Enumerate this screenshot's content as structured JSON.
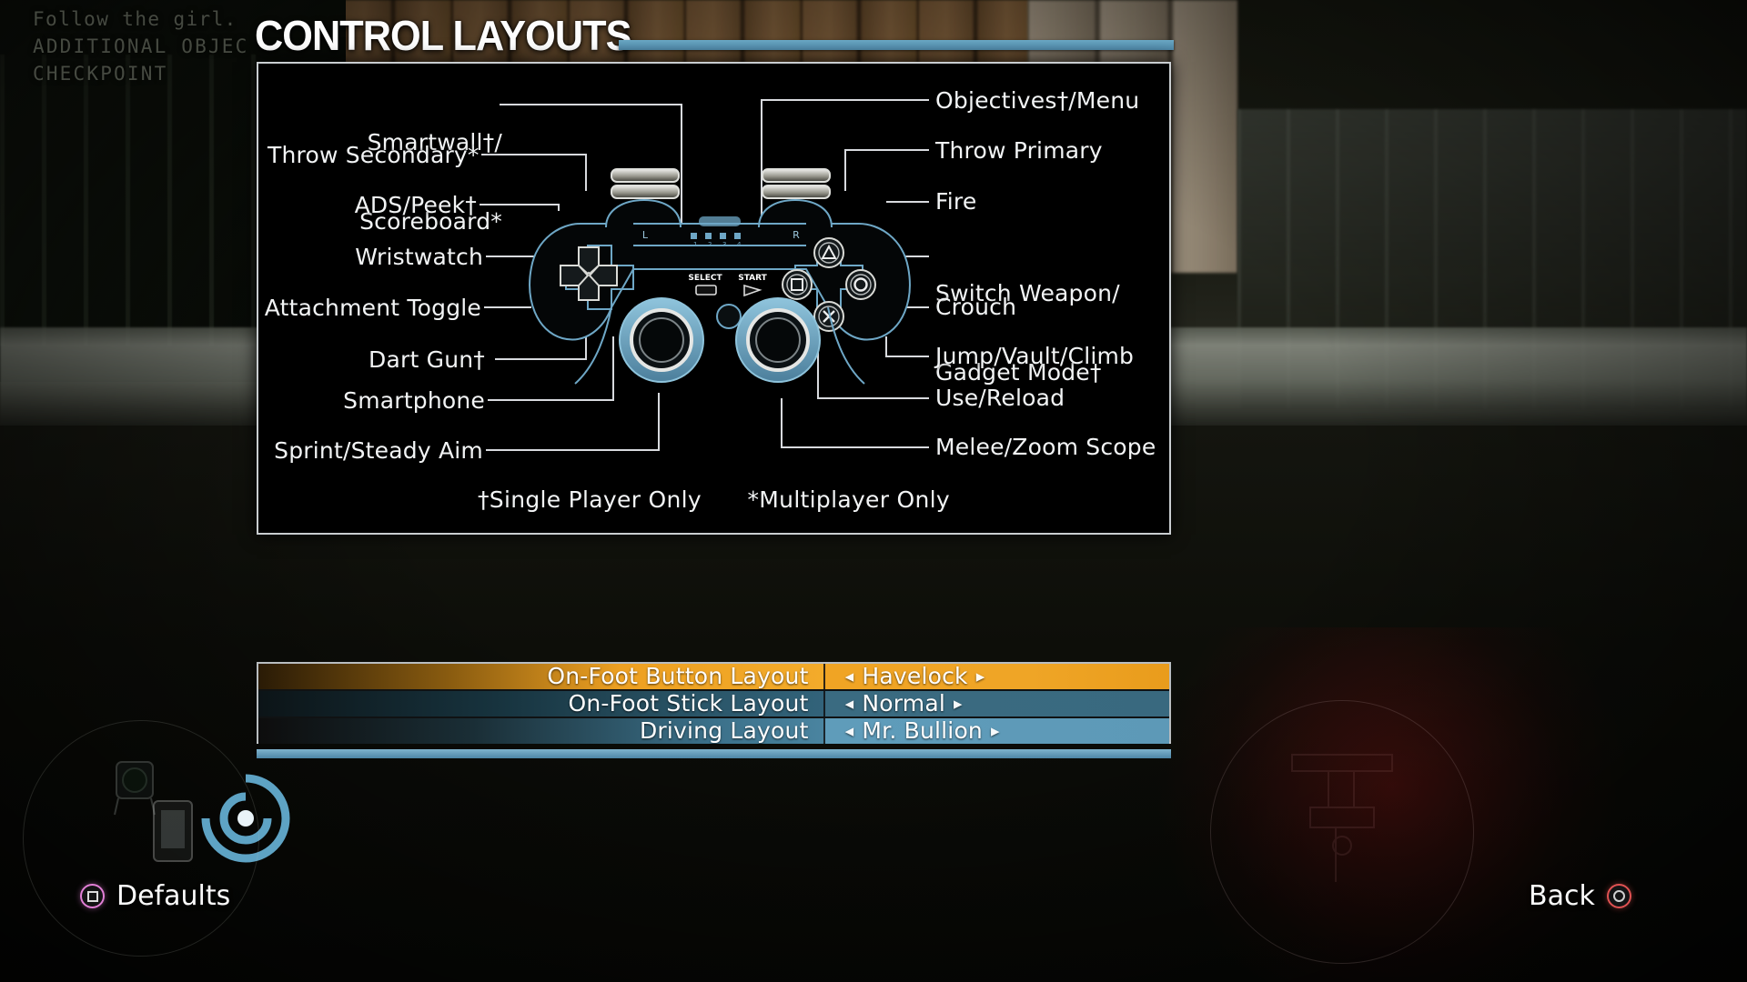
{
  "hud": {
    "line1": "Follow the girl.",
    "line2": "ADDITIONAL OBJEC",
    "line3": "CHECKPOINT"
  },
  "header": {
    "title": "CONTROL LAYOUTS"
  },
  "diagram": {
    "left_labels": [
      {
        "id": "smartwall",
        "line1": "Smartwall†/",
        "line2": "Scoreboard*"
      },
      {
        "id": "throw-secondary",
        "line1": "Throw Secondary*",
        "line2": ""
      },
      {
        "id": "ads-peek",
        "line1": "ADS/Peek†",
        "line2": ""
      },
      {
        "id": "wristwatch",
        "line1": "Wristwatch",
        "line2": ""
      },
      {
        "id": "attachment-toggle",
        "line1": "Attachment Toggle",
        "line2": ""
      },
      {
        "id": "dart-gun",
        "line1": "Dart Gun†",
        "line2": ""
      },
      {
        "id": "smartphone",
        "line1": "Smartphone",
        "line2": ""
      },
      {
        "id": "sprint-steady-aim",
        "line1": "Sprint/Steady Aim",
        "line2": ""
      }
    ],
    "right_labels": [
      {
        "id": "objectives-menu",
        "line1": "Objectives†/Menu",
        "line2": ""
      },
      {
        "id": "throw-primary",
        "line1": "Throw Primary",
        "line2": ""
      },
      {
        "id": "fire",
        "line1": "Fire",
        "line2": ""
      },
      {
        "id": "switch-weapon",
        "line1": "Switch Weapon/",
        "line2": "Gadget Mode†"
      },
      {
        "id": "crouch",
        "line1": "Crouch",
        "line2": ""
      },
      {
        "id": "jump-vault-climb",
        "line1": "Jump/Vault/Climb",
        "line2": ""
      },
      {
        "id": "use-reload",
        "line1": "Use/Reload",
        "line2": ""
      },
      {
        "id": "melee-zoom-scope",
        "line1": "Melee/Zoom Scope",
        "line2": ""
      }
    ],
    "controller_text": {
      "left_shoulder": "L",
      "right_shoulder": "R",
      "select": "SELECT",
      "start": "START"
    },
    "footnote_single": "†Single Player Only",
    "footnote_multi": "*Multiplayer Only"
  },
  "options": [
    {
      "name": "On-Foot Button Layout",
      "value": "Havelock",
      "selected": true
    },
    {
      "name": "On-Foot Stick Layout",
      "value": "Normal",
      "selected": false
    },
    {
      "name": "Driving Layout",
      "value": "Mr. Bullion",
      "selected": false
    }
  ],
  "arrows": {
    "left": "◂",
    "right": "▸"
  },
  "footer": {
    "defaults_label": "Defaults",
    "defaults_button": "square-button-icon",
    "back_label": "Back",
    "back_button": "circle-button-icon"
  },
  "colors": {
    "accent_bar": "#6aa7c4",
    "selected_row": "#f0a424",
    "row_stick": "#3a6b81",
    "row_driving": "#5f9cba",
    "square_button": "#e27fd6",
    "circle_button": "#e05252",
    "panel_border": "#c9cdd0",
    "text": "#f2f4f5"
  }
}
